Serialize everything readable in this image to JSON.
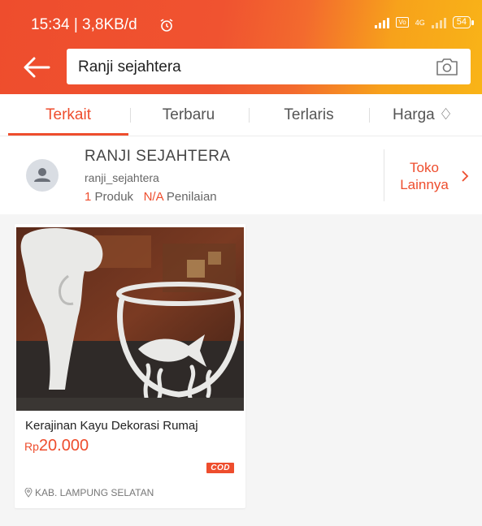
{
  "status_bar": {
    "time": "15:34 | 3,8KB/d",
    "battery": "54",
    "network": "4G"
  },
  "search": {
    "query": "Ranji sejahtera"
  },
  "tabs": [
    {
      "label": "Terkait",
      "active": true
    },
    {
      "label": "Terbaru",
      "active": false
    },
    {
      "label": "Terlaris",
      "active": false
    },
    {
      "label": "Harga ♢",
      "active": false
    }
  ],
  "shop": {
    "name": "RANJI SEJAHTERA",
    "username": "ranji_sejahtera",
    "product_count": "1",
    "product_label": "Produk",
    "rating": "N/A",
    "rating_label": "Penilaian",
    "more_line1": "Toko",
    "more_line2": "Lainnya"
  },
  "products": [
    {
      "title": "Kerajinan Kayu Dekorasi Rumaj",
      "currency": "Rp",
      "price": "20.000",
      "badge": "COD",
      "location": "KAB. LAMPUNG SELATAN"
    }
  ],
  "colors": {
    "accent": "#ee4d2d",
    "header_gradient_end": "#f9b417"
  }
}
